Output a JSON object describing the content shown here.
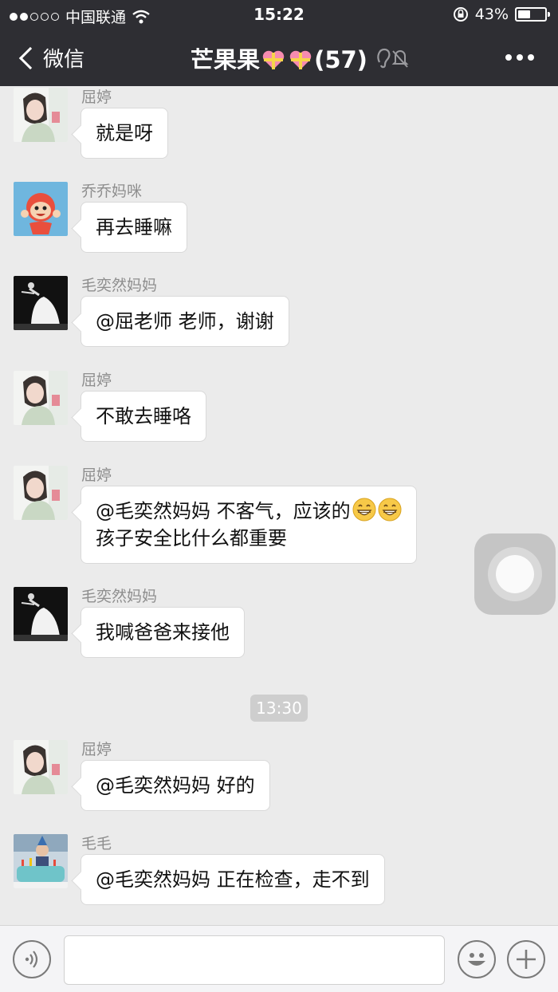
{
  "status_bar": {
    "carrier": "中国联通",
    "time": "15:22",
    "battery": "43%",
    "battery_level": 0.43
  },
  "nav": {
    "back_label": "微信",
    "title_prefix": "芒果果",
    "title_count": "(57)"
  },
  "messages": [
    {
      "sender": "屈婷",
      "lines": [
        "就是呀"
      ],
      "avatar": "girl-photo"
    },
    {
      "sender": "乔乔妈咪",
      "lines": [
        "再去睡嘛"
      ],
      "avatar": "cartoon-ponyo"
    },
    {
      "sender": "毛奕然妈妈",
      "lines": [
        "@屈老师 老师，谢谢"
      ],
      "avatar": "ballet-dancer-photo"
    },
    {
      "sender": "屈婷",
      "lines": [
        "不敢去睡咯"
      ],
      "avatar": "girl-photo"
    },
    {
      "sender": "屈婷",
      "lines": [
        "@毛奕然妈妈 不客气，应该的",
        "孩子安全比什么都重要"
      ],
      "avatar": "girl-photo",
      "emojis": [
        "grin-emoji",
        "grin-emoji"
      ]
    },
    {
      "sender": "毛奕然妈妈",
      "lines": [
        "我喊爸爸来接他"
      ],
      "avatar": "ballet-dancer-photo"
    },
    {
      "sender": "屈婷",
      "lines": [
        "@毛奕然妈妈 好的"
      ],
      "avatar": "girl-photo"
    },
    {
      "sender": "毛毛",
      "lines": [
        "@毛奕然妈妈 正在检查，走不到"
      ],
      "avatar": "child-birthday-photo"
    }
  ],
  "timestamp": "13:30",
  "colors": {
    "header_bg": "#2e2e33",
    "chat_bg": "#ebebeb",
    "bubble_bg": "#ffffff",
    "sender_text": "#8e8e8e"
  }
}
